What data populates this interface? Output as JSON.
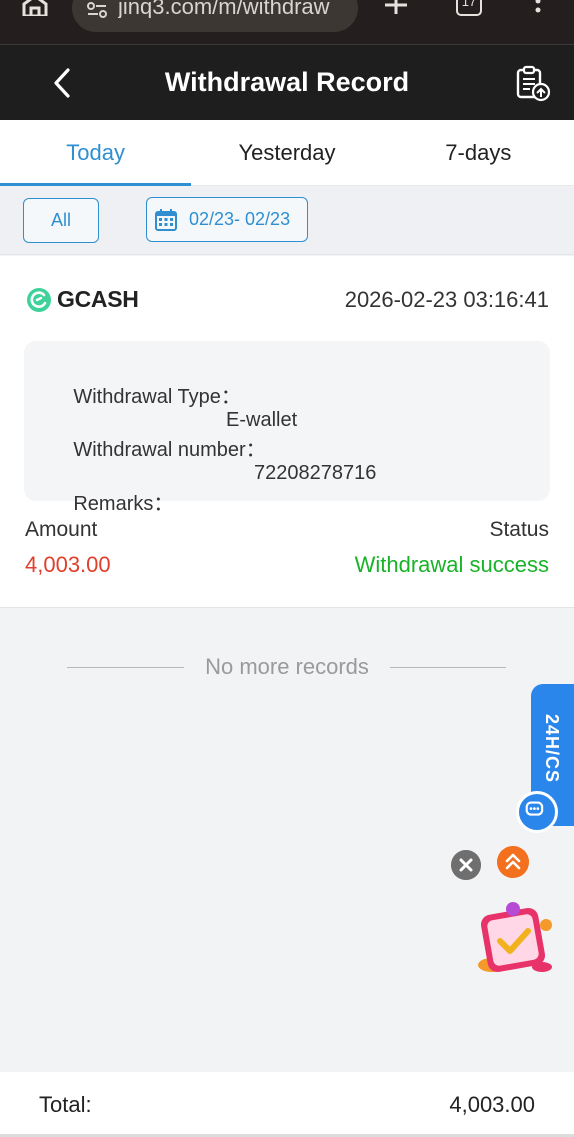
{
  "browser": {
    "url": "jinq3.com/m/withdraw",
    "tab_count": "17",
    "icons": [
      "home-icon",
      "site-settings-icon",
      "plus-icon",
      "tabs-icon",
      "more-icon"
    ]
  },
  "header": {
    "title": "Withdrawal Record",
    "icons": [
      "back-icon",
      "clipboard-upload-icon"
    ]
  },
  "tabs": [
    {
      "label": "Today",
      "active": true
    },
    {
      "label": "Yesterday",
      "active": false
    },
    {
      "label": "7-days",
      "active": false
    }
  ],
  "filters": {
    "all_label": "All",
    "date_range": "02/23- 02/23"
  },
  "record": {
    "method": "GCASH",
    "datetime": "2026-02-23 03:16:41",
    "type_label": "Withdrawal Type：",
    "type_value": "E-wallet",
    "number_label": "Withdrawal number：",
    "number_value": "72208278716",
    "remarks_label": "Remarks：",
    "remarks_value": "",
    "amount_label": "Amount",
    "amount_value": "4,003.00",
    "status_label": "Status",
    "status_value": "Withdrawal success"
  },
  "list_end_text": "No more records",
  "floating": {
    "cs_label": "24H/CS"
  },
  "total": {
    "label": "Total:",
    "value": "4,003.00"
  },
  "colors": {
    "accent": "#2f8fd0",
    "amount": "#e0402b",
    "success": "#18b328",
    "header_bg": "#1e1e1e"
  }
}
